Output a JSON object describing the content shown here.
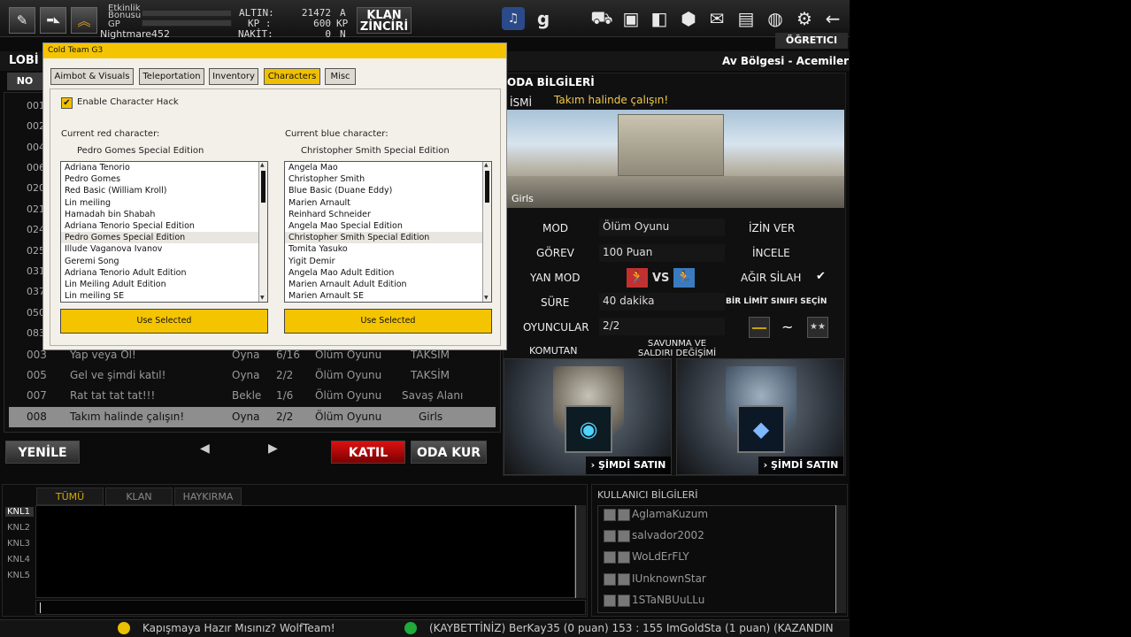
{
  "topbar": {
    "stat_labels": [
      "Etkinlik",
      "Bonusu",
      "GP"
    ],
    "username": "Nightmare452",
    "currency": [
      {
        "label": "ALTIN:",
        "value": "21472",
        "unit": "A"
      },
      {
        "label": "KP :",
        "value": "600",
        "unit": "KP"
      },
      {
        "label": "NAKİT:",
        "value": "0",
        "unit": "N"
      }
    ],
    "klan_button": {
      "line1": "KLAN",
      "line2": "ZİNCİRİ"
    },
    "right_icons": [
      "wolfteam-logo-icon",
      "g-logo-icon",
      "cart-icon",
      "briefcase-icon",
      "book-icon",
      "box-icon",
      "mail-icon",
      "folder-user-icon",
      "globe-icon",
      "gear-icon",
      "back-arrow-icon"
    ],
    "ogretici": "ÖĞRETICI"
  },
  "cheat": {
    "title": "Cold Team G3",
    "tabs": [
      "Aimbot & Visuals",
      "Teleportation",
      "Inventory",
      "Characters",
      "Misc"
    ],
    "active_tab": "Characters",
    "enable_label": "Enable Character Hack",
    "red_label": "Current red character:",
    "red_value": "Pedro Gomes Special Edition",
    "blue_label": "Current blue character:",
    "blue_value": "Christopher Smith Special Edition",
    "red_list": [
      "Adriana Tenorio",
      "Pedro Gomes",
      "Red Basic (William Kroll)",
      "Lin meiling",
      "Hamadah bin Shabah",
      "Adriana Tenorio Special Edition",
      "Pedro Gomes Special Edition",
      "Illude Vaganova Ivanov",
      "Geremi Song",
      "Adriana Tenorio Adult Edition",
      "Lin Meiling Adult Edition",
      "Lin meiling SE"
    ],
    "blue_list": [
      "Angela Mao",
      "Christopher Smith",
      "Blue Basic (Duane Eddy)",
      "Marien Arnault",
      "Reinhard Schneider",
      "Angela Mao Special Edition",
      "Christopher Smith Special Edition",
      "Tomita Yasuko",
      "Yigit Demir",
      "Angela Mao Adult Edition",
      "Marien Arnault Adult Edition",
      "Marien Arnault SE"
    ],
    "use_selected": "Use Selected"
  },
  "lobby": {
    "title": "LOBİ",
    "no_header": "NO",
    "side_numbers": [
      "001",
      "002",
      "004",
      "006",
      "020",
      "021",
      "024",
      "025",
      "031",
      "037",
      "050",
      "083"
    ],
    "rows": [
      {
        "no": "003",
        "name": "Yap veya Öl!",
        "status": "Oyna",
        "players": "6/16",
        "mode": "Ölüm Oyunu",
        "map": "TAKSİM"
      },
      {
        "no": "005",
        "name": "Gel ve şimdi katıl!",
        "status": "Oyna",
        "players": "2/2",
        "mode": "Ölüm Oyunu",
        "map": "TAKSİM"
      },
      {
        "no": "007",
        "name": "Rat tat tat tat!!!",
        "status": "Bekle",
        "players": "1/6",
        "mode": "Ölüm Oyunu",
        "map": "Savaş Alanı"
      },
      {
        "no": "008",
        "name": "Takım halinde çalışın!",
        "status": "Oyna",
        "players": "2/2",
        "mode": "Ölüm Oyunu",
        "map": "Girls"
      }
    ],
    "refresh": "YENİLE",
    "join": "KATIL",
    "create": "ODA KUR"
  },
  "room": {
    "region": "Av Bölgesi - Acemiler",
    "header": "ODA BİLGİLERİ",
    "name_label": "İSMİ",
    "name_value": "Takım halinde çalışın!",
    "map_label": "Girls",
    "fields": [
      {
        "label": "MOD",
        "value": "Ölüm Oyunu"
      },
      {
        "label": "GÖREV",
        "value": "100 Puan"
      },
      {
        "label": "YAN MOD",
        "value": ""
      },
      {
        "label": "SÜRE",
        "value": "40 dakika"
      },
      {
        "label": "OYUNCULAR",
        "value": "2/2"
      }
    ],
    "vs": "VS",
    "right_labels": [
      "İZİN VER",
      "İNCELE",
      "AĞIR SİLAH",
      "BİR LİMİT SINIFI SEÇİN"
    ],
    "komutan": "KOMUTAN",
    "savunma_line1": "SAVUNMA VE",
    "savunma_line2": "SALDIRI DEĞİŞİMİ",
    "buy_now": "› ŞİMDİ SATIN AL"
  },
  "chat": {
    "tabs": [
      "TÜMÜ",
      "KLAN",
      "HAYKIRMA"
    ],
    "channels": [
      "KNL1",
      "KNL2",
      "KNL3",
      "KNL4",
      "KNL5"
    ]
  },
  "users": {
    "header": "KULLANICI BİLGİLERİ",
    "list": [
      "AglamaKuzum",
      "salvador2002",
      "WoLdErFLY",
      "IUnknownStar",
      "1STaNBUuLLu"
    ]
  },
  "ticker": {
    "left": "Kapışmaya Hazır Mısınız? WolfTeam!",
    "right": "(KAYBETTİNİZ) BerKay35 (0 puan) 153 : 155 ImGoldSta (1 puan) (KAZANDIN"
  },
  "colors": {
    "accent_yellow": "#f5c400",
    "red_button": "#c40000",
    "selected_row": "#8e8e8e"
  }
}
